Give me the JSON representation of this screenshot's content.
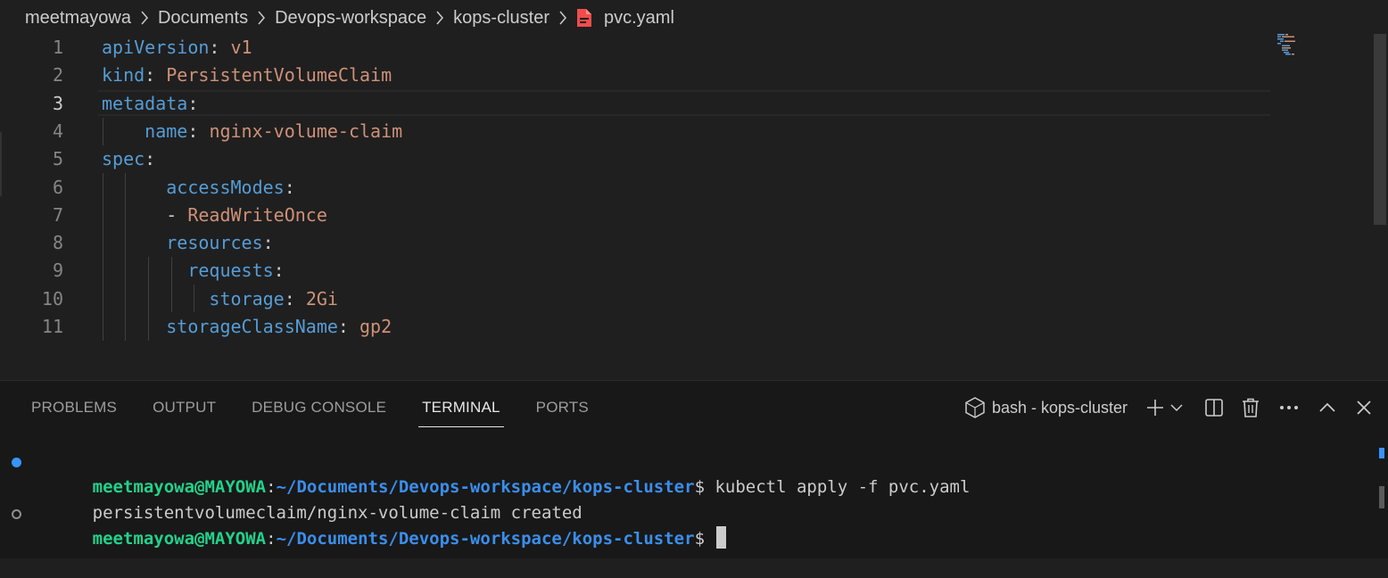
{
  "breadcrumb": {
    "items": [
      "meetmayowa",
      "Documents",
      "Devops-workspace",
      "kops-cluster"
    ],
    "file": "pvc.yaml",
    "file_icon": "yaml-file-icon"
  },
  "editor": {
    "active_line": 3,
    "lines": [
      {
        "num": "1",
        "tokens": [
          {
            "t": "apiVersion",
            "c": "k"
          },
          {
            "t": ": ",
            "c": "p"
          },
          {
            "t": "v1",
            "c": "v"
          }
        ]
      },
      {
        "num": "2",
        "tokens": [
          {
            "t": "kind",
            "c": "k"
          },
          {
            "t": ": ",
            "c": "p"
          },
          {
            "t": "PersistentVolumeClaim",
            "c": "v"
          }
        ]
      },
      {
        "num": "3",
        "tokens": [
          {
            "t": "metadata",
            "c": "k"
          },
          {
            "t": ":",
            "c": "p"
          }
        ]
      },
      {
        "num": "4",
        "tokens": [
          {
            "t": "    ",
            "c": "p"
          },
          {
            "t": "name",
            "c": "k"
          },
          {
            "t": ": ",
            "c": "p"
          },
          {
            "t": "nginx-volume-claim",
            "c": "v"
          }
        ]
      },
      {
        "num": "5",
        "tokens": [
          {
            "t": "spec",
            "c": "k"
          },
          {
            "t": ":",
            "c": "p"
          }
        ]
      },
      {
        "num": "6",
        "tokens": [
          {
            "t": "      ",
            "c": "p"
          },
          {
            "t": "accessModes",
            "c": "k"
          },
          {
            "t": ":",
            "c": "p"
          }
        ]
      },
      {
        "num": "7",
        "tokens": [
          {
            "t": "      - ",
            "c": "p"
          },
          {
            "t": "ReadWriteOnce",
            "c": "v"
          }
        ]
      },
      {
        "num": "8",
        "tokens": [
          {
            "t": "      ",
            "c": "p"
          },
          {
            "t": "resources",
            "c": "k"
          },
          {
            "t": ":",
            "c": "p"
          }
        ]
      },
      {
        "num": "9",
        "tokens": [
          {
            "t": "        ",
            "c": "p"
          },
          {
            "t": "requests",
            "c": "k"
          },
          {
            "t": ":",
            "c": "p"
          }
        ]
      },
      {
        "num": "10",
        "tokens": [
          {
            "t": "          ",
            "c": "p"
          },
          {
            "t": "storage",
            "c": "k"
          },
          {
            "t": ": ",
            "c": "p"
          },
          {
            "t": "2Gi",
            "c": "v"
          }
        ]
      },
      {
        "num": "11",
        "tokens": [
          {
            "t": "      ",
            "c": "p"
          },
          {
            "t": "storageClassName",
            "c": "k"
          },
          {
            "t": ": ",
            "c": "p"
          },
          {
            "t": "gp2",
            "c": "v"
          }
        ]
      }
    ]
  },
  "panel": {
    "tabs": [
      {
        "label": "PROBLEMS",
        "active": false
      },
      {
        "label": "OUTPUT",
        "active": false
      },
      {
        "label": "DEBUG CONSOLE",
        "active": false
      },
      {
        "label": "TERMINAL",
        "active": true
      },
      {
        "label": "PORTS",
        "active": false
      }
    ],
    "terminal_name": "bash - kops-cluster"
  },
  "terminal": {
    "lines": [
      {
        "decoration": "filled",
        "user": "meetmayowa@MAYOWA",
        "colon": ":",
        "path": "~/Documents/Devops-workspace/kops-cluster",
        "prompt": "$ ",
        "command": "kubectl apply -f pvc.yaml"
      },
      {
        "output": "persistentvolumeclaim/nginx-volume-claim created"
      },
      {
        "decoration": "hollow",
        "user": "meetmayowa@MAYOWA",
        "colon": ":",
        "path": "~/Documents/Devops-workspace/kops-cluster",
        "prompt": "$ ",
        "command": "",
        "cursor": true
      }
    ]
  },
  "colors": {
    "key": "#569cd6",
    "value": "#ce9178",
    "terminal_user": "#23d18b",
    "terminal_path": "#3b8eea",
    "file_icon": "#f14c4c"
  }
}
